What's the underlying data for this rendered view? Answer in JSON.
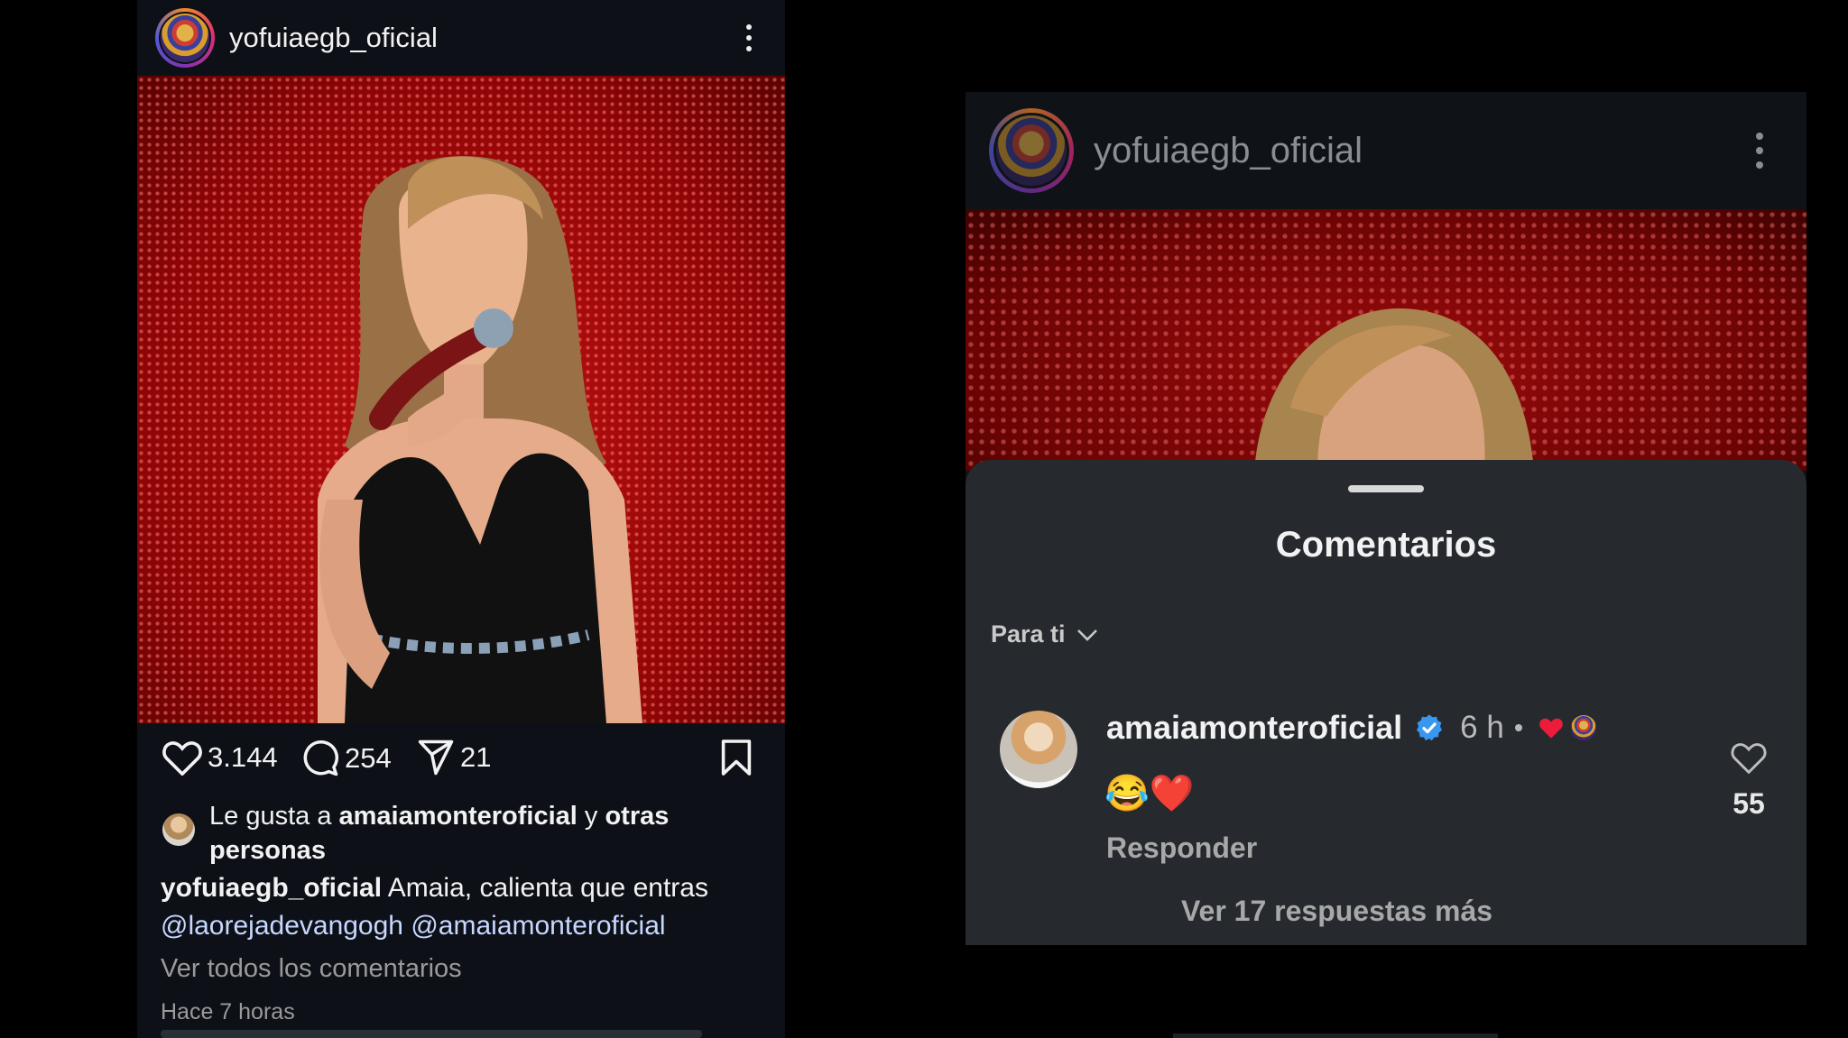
{
  "left_post": {
    "username": "yofuiaegb_oficial",
    "likes": "3.144",
    "comments": "254",
    "shares": "21",
    "liked_by_prefix": "Le gusta a ",
    "liked_by_user": "amaiamonteroficial",
    "liked_by_middle": " y ",
    "liked_by_suffix": "otras personas",
    "caption_user": "yofuiaegb_oficial",
    "caption_text": " Amaia, calienta que entras",
    "mention_1": "@laorejadevangogh",
    "mention_2": "@amaiamonteroficial",
    "view_all_comments": "Ver todos los comentarios",
    "time_ago": "Hace 7 horas"
  },
  "right_post": {
    "username": "yofuiaegb_oficial",
    "sheet_title": "Comentarios",
    "sort_label": "Para ti",
    "comment": {
      "author": "amaiamonteroficial",
      "time": "6 h",
      "text": "😂❤️",
      "reply_label": "Responder",
      "like_count": "55"
    },
    "more_replies": "Ver 17 respuestas más"
  },
  "colors": {
    "background": "#000000",
    "post_bg": "#0d1117",
    "sheet_bg": "#262a2f",
    "mention": "#c7d7ff",
    "verified": "#3897f0",
    "heart": "#ed1c3a"
  },
  "icons": {
    "like": "heart-icon",
    "comment": "comment-bubble-icon",
    "share": "send-icon",
    "save": "bookmark-icon",
    "menu": "kebab-menu-icon",
    "sort": "chevron-down-icon",
    "verified": "verified-badge-icon"
  }
}
